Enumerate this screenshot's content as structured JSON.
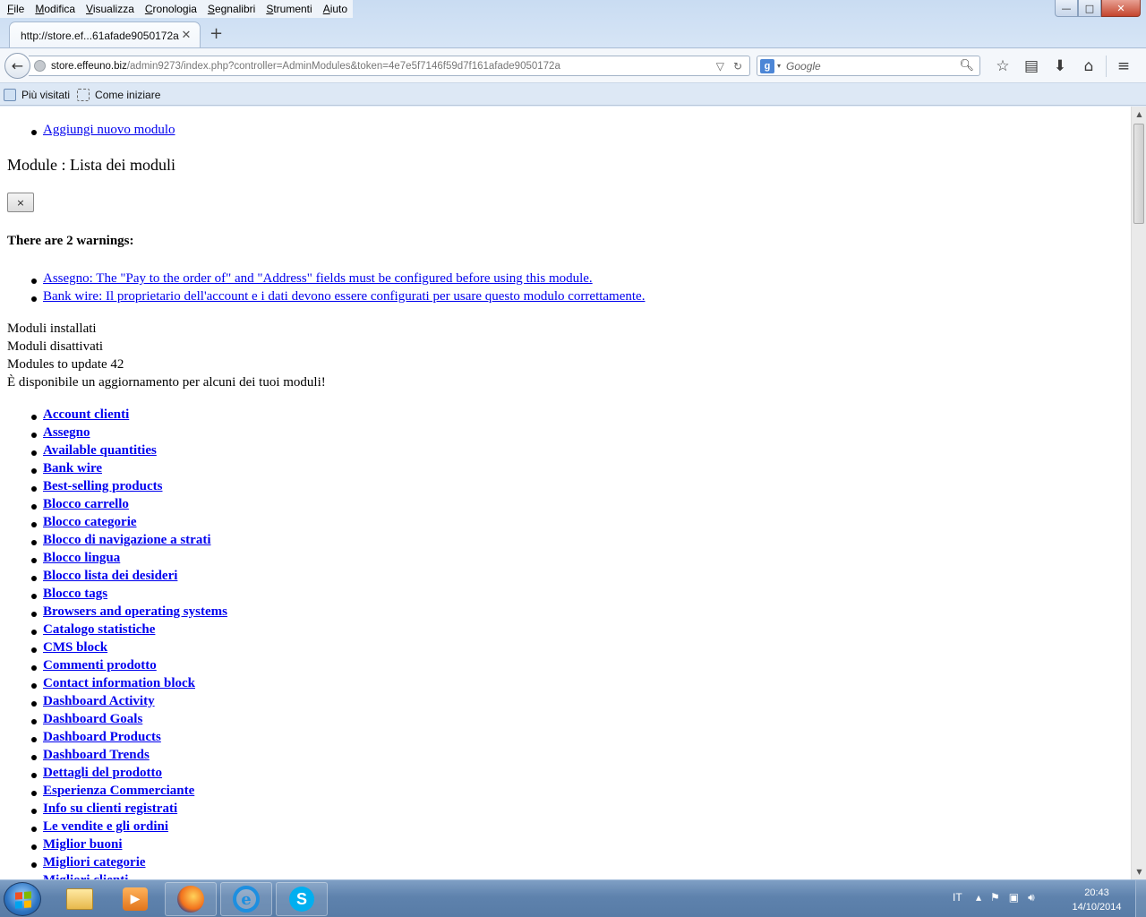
{
  "menubar": {
    "items": [
      {
        "accel": "F",
        "rest": "ile"
      },
      {
        "accel": "M",
        "rest": "odifica"
      },
      {
        "accel": "V",
        "rest": "isualizza"
      },
      {
        "accel": "C",
        "rest": "ronologia"
      },
      {
        "accel": "S",
        "rest": "egnalibri"
      },
      {
        "accel": "S",
        "rest": "trumenti"
      },
      {
        "accel": "A",
        "rest": "iuto"
      }
    ]
  },
  "window_controls": {
    "minimize": "—",
    "maximize": "□",
    "close": "✕"
  },
  "tab": {
    "title": "http://store.ef...61afade9050172a",
    "close": "✕",
    "new_tab": "+"
  },
  "address_bar": {
    "url_host": "store.effeuno.biz",
    "url_path": "/admin9273/index.php?controller=AdminModules&token=4e7e5f7146f59d7f161afade9050172a",
    "back_icon": "arrow-left-icon",
    "dropdown_icon": "▽",
    "reload_icon": "↻"
  },
  "search_bar": {
    "engine_badge": "g",
    "placeholder": "Google",
    "icon": "⌕"
  },
  "toolbar_icons": [
    "star-icon",
    "reading-list-icon",
    "download-icon",
    "home-icon",
    "menu-icon"
  ],
  "bookmarks": {
    "items": [
      "Più visitati",
      "Come iniziare"
    ]
  },
  "page": {
    "add_module_link": "Aggiungi nuovo modulo",
    "title": "Module : Lista dei moduli",
    "close_button": "×",
    "warnings_heading": "There are 2 warnings:",
    "warnings": [
      "Assegno: The \"Pay to the order of\" and \"Address\" fields must be configured before using this module.",
      "Bank wire: Il proprietario dell'account e i dati devono essere configurati per usare questo modulo correttamente."
    ],
    "status_lines": [
      "Moduli installati",
      "Moduli disattivati",
      "Modules to update 42",
      "È disponibile un aggiornamento per alcuni dei tuoi moduli!"
    ],
    "modules": [
      "Account clienti",
      "Assegno",
      "Available quantities",
      "Bank wire",
      "Best-selling products",
      "Blocco carrello",
      "Blocco categorie",
      "Blocco di navigazione a strati",
      "Blocco lingua",
      "Blocco lista dei desideri",
      "Blocco tags",
      "Browsers and operating systems",
      "Catalogo statistiche",
      "CMS block",
      "Commenti prodotto",
      "Contact information block",
      "Dashboard Activity",
      "Dashboard Goals",
      "Dashboard Products",
      "Dashboard Trends",
      "Dettagli del prodotto",
      "Esperienza Commerciante",
      "Info su clienti registrati",
      "Le vendite e gli ordini",
      "Miglior buoni",
      "Migliori categorie",
      "Migliori clienti"
    ]
  },
  "taskbar": {
    "apps": [
      "file-explorer-icon",
      "media-player-icon",
      "firefox-icon",
      "internet-explorer-icon",
      "skype-icon"
    ],
    "ie_glyph": "e",
    "skype_glyph": "S",
    "language": "IT",
    "clock_time": "20:43",
    "clock_date": "14/10/2014"
  }
}
